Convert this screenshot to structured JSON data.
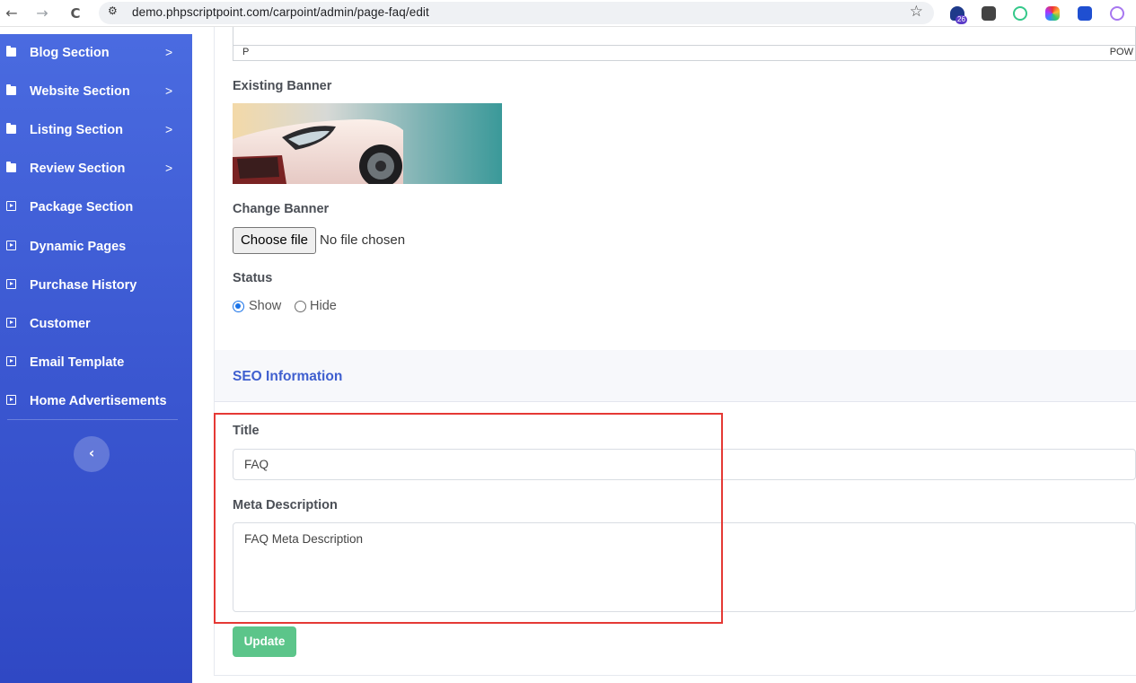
{
  "browser": {
    "url": "demo.phpscriptpoint.com/carpoint/admin/page-faq/edit",
    "back_glyph": "←",
    "forward_glyph": "→",
    "reload_glyph": "C",
    "ext_badge": "26"
  },
  "sidebar": {
    "items": [
      {
        "label": "Blog Section",
        "icon": "folder-icon",
        "has_chevron": true
      },
      {
        "label": "Website Section",
        "icon": "folder-icon",
        "has_chevron": true
      },
      {
        "label": "Listing Section",
        "icon": "folder-icon",
        "has_chevron": true
      },
      {
        "label": "Review Section",
        "icon": "folder-icon",
        "has_chevron": true
      },
      {
        "label": "Package Section",
        "icon": "caret-square-icon",
        "has_chevron": false
      },
      {
        "label": "Dynamic Pages",
        "icon": "caret-square-icon",
        "has_chevron": false
      },
      {
        "label": "Purchase History",
        "icon": "caret-square-icon",
        "has_chevron": false
      },
      {
        "label": "Customer",
        "icon": "caret-square-icon",
        "has_chevron": false
      },
      {
        "label": "Email Template",
        "icon": "caret-square-icon",
        "has_chevron": false
      },
      {
        "label": "Home Advertisements",
        "icon": "caret-square-icon",
        "has_chevron": false
      }
    ],
    "chevron_glyph": ">",
    "toggle_glyph": "‹"
  },
  "editor": {
    "path": "P",
    "powered": "POW"
  },
  "form": {
    "existing_banner_label": "Existing Banner",
    "change_banner_label": "Change Banner",
    "choose_file_label": "Choose file",
    "no_file_text": "No file chosen",
    "status_label": "Status",
    "status_options": [
      "Show",
      "Hide"
    ],
    "status_selected": "Show"
  },
  "seo": {
    "section_title": "SEO Information",
    "title_label": "Title",
    "title_value": "FAQ",
    "meta_label": "Meta Description",
    "meta_value": "FAQ Meta Description"
  },
  "actions": {
    "update_label": "Update"
  },
  "colors": {
    "sidebar": "#3f5fd6",
    "accent": "#3f5fcf",
    "update_button": "#5cc58a",
    "highlight_box": "#e53935"
  }
}
